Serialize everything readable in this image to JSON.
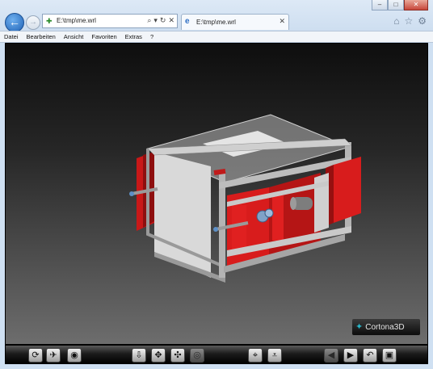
{
  "window": {
    "minimize_glyph": "‒",
    "maximize_glyph": "□",
    "close_glyph": "✕"
  },
  "nav": {
    "back_glyph": "←",
    "forward_glyph": "→"
  },
  "address_bar": {
    "url": "E:\\tmp\\me.wrl",
    "favicon_glyph": "✚",
    "search_glyph": "⌕",
    "dropdown_glyph": "▾",
    "refresh_glyph": "↻",
    "stop_glyph": "✕"
  },
  "tab": {
    "label": "E:\\tmp\\me.wrl",
    "icon_glyph": "e",
    "close_glyph": "✕"
  },
  "ie_tools": {
    "home_glyph": "⌂",
    "favorites_glyph": "☆",
    "settings_glyph": "⚙"
  },
  "menu": [
    "Datei",
    "Bearbeiten",
    "Ansicht",
    "Favoriten",
    "Extras",
    "?"
  ],
  "logo": {
    "mark_glyph": "✦",
    "text": "Cortona3D"
  },
  "toolbar": {
    "rotate_glyph": "⟳",
    "plane_glyph": "✈",
    "study_glyph": "◉",
    "goto_glyph": "⇩",
    "pan_glyph": "✥",
    "slide_glyph": "✣",
    "tilt_glyph": "◎",
    "restore_glyph": "⌖",
    "align_glyph": "⩡",
    "prev_glyph": "◀",
    "next_glyph": "▶",
    "undo_glyph": "↶",
    "fit_glyph": "▣"
  },
  "colors": {
    "accent_red": "#d81c1c",
    "steel": "#a8a8a8",
    "brand_cyan": "#29b6c8"
  }
}
